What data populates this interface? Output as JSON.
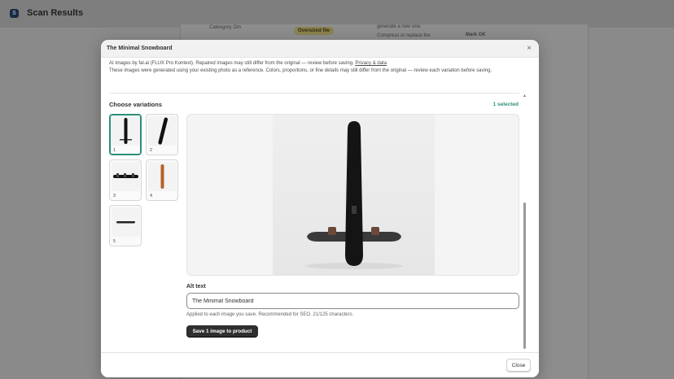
{
  "app": {
    "title": "Scan Results",
    "logo_letter": "S"
  },
  "background": {
    "row_text_1": "Cateogory Om",
    "badge": "Oversized file",
    "row_text_2": "generate a new one.",
    "row_text_3": "Compress or replace the",
    "action": "Mark OK"
  },
  "modal": {
    "title": "The Minimal Snowboard",
    "notice_line1": "AI images by fal.ai (FLUX Pro Kontext). Repaired images may still differ from the original — review before saving.",
    "privacy_link": "Privacy & data",
    "notice_line2": "These images were generated using your existing photo as a reference. Colors, proportions, or fine details may still differ from the original — review each variation before saving.",
    "choose_variations_label": "Choose variations",
    "selected_count": "1 selected",
    "variations": [
      {
        "number": "1",
        "selected": true,
        "icon": "snowboard-black-vertical"
      },
      {
        "number": "2",
        "selected": false,
        "icon": "snowboard-black-diagonal"
      },
      {
        "number": "3",
        "selected": false,
        "icon": "snowboard-horizontal-bindings"
      },
      {
        "number": "4",
        "selected": false,
        "icon": "snowboard-orange-vertical"
      },
      {
        "number": "5",
        "selected": false,
        "icon": "snowboard-small-horizontal"
      }
    ],
    "alt_text_label": "Alt text",
    "alt_text_value": "The Minimal Snowboard",
    "alt_help": "Applied to each image you save. Recommended for SEO. 21/125 characters.",
    "save_button": "Save 1 image to product",
    "close_button": "Close",
    "close_icon": "×"
  },
  "colors": {
    "accent": "#2a8f7a",
    "primary_button": "#2f2f2f"
  }
}
